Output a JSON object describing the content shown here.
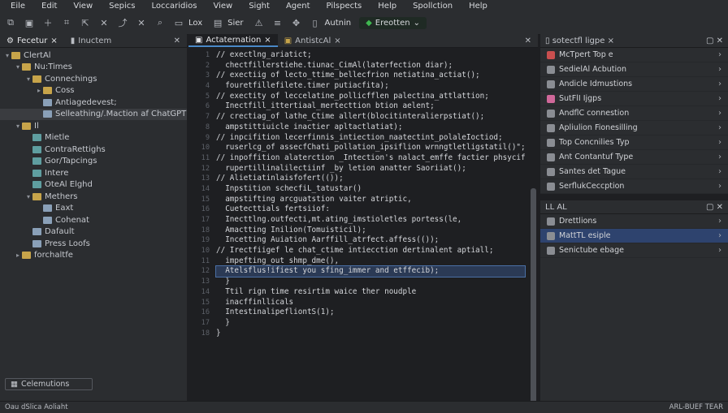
{
  "menu": [
    "Eile",
    "Edit",
    "View",
    "Sepics",
    "Loccaridios",
    "View",
    "Sight",
    "Agent",
    "Pilspects",
    "Help",
    "Spollction",
    "Help"
  ],
  "toolbar": {
    "icons": [
      "copy-icon",
      "save-icon",
      "add-icon",
      "graph-icon",
      "export-icon",
      "close-icon",
      "share-icon",
      "pin-icon",
      "search-icon"
    ],
    "item1_label": "Lox",
    "item2_label": "Sier",
    "item3_label": "Autnin",
    "run_label": "Ereotten"
  },
  "left_tabs": [
    {
      "label": "Fecetur"
    },
    {
      "label": "Inuctem"
    }
  ],
  "tree": [
    {
      "label": "ClertAl",
      "depth": 0,
      "arrow": "▾",
      "kind": "folder"
    },
    {
      "label": "Nu:Times",
      "depth": 1,
      "arrow": "▾",
      "kind": "folder"
    },
    {
      "label": "Connechings",
      "depth": 2,
      "arrow": "▾",
      "kind": "folder"
    },
    {
      "label": "Coss",
      "depth": 3,
      "arrow": "▸",
      "kind": "folder"
    },
    {
      "label": "Antiagedevest;",
      "depth": 3,
      "arrow": "",
      "kind": "file"
    },
    {
      "label": "Selleathing/.Maction af ChatGPT",
      "depth": 3,
      "arrow": "",
      "kind": "file",
      "selected": true
    },
    {
      "label": "Il",
      "depth": 1,
      "arrow": "▾",
      "kind": "folder"
    },
    {
      "label": "Mietle",
      "depth": 2,
      "arrow": "",
      "kind": "py"
    },
    {
      "label": "ContraRettighs",
      "depth": 2,
      "arrow": "",
      "kind": "py"
    },
    {
      "label": "Gor/Tapcings",
      "depth": 2,
      "arrow": "",
      "kind": "py"
    },
    {
      "label": "Intere",
      "depth": 2,
      "arrow": "",
      "kind": "py"
    },
    {
      "label": "OteAl Elghd",
      "depth": 2,
      "arrow": "",
      "kind": "py"
    },
    {
      "label": "Methers",
      "depth": 2,
      "arrow": "▾",
      "kind": "folder"
    },
    {
      "label": "Eaxt",
      "depth": 3,
      "arrow": "",
      "kind": "file"
    },
    {
      "label": "Cohenat",
      "depth": 3,
      "arrow": "",
      "kind": "file"
    },
    {
      "label": "Dafault",
      "depth": 2,
      "arrow": "",
      "kind": "file"
    },
    {
      "label": "Press Loofs",
      "depth": 2,
      "arrow": "",
      "kind": "file"
    },
    {
      "label": "forchaltfe",
      "depth": 1,
      "arrow": "▸",
      "kind": "folder"
    }
  ],
  "left_footer": {
    "button": "Celemutions",
    "status": "Oau dSlica Aoliaht"
  },
  "editor_tabs": [
    {
      "label": "Actaternation",
      "active": true
    },
    {
      "label": "AntistcAl",
      "active": false
    }
  ],
  "code_lines": [
    "// exectlng_ariatict;",
    "  chectfillerstiehe.tiunac_CimAl(laterfection diar);",
    "// exectiig of lecto_ttime_bellecfrion netiatina_actiat();",
    "  fouretfillefilete.timer putiacfita);",
    "// exectity of leccelatine_pollicfflen palectina_attlattion;",
    "  Inectfill_ittertiaal_mertecttion btion aelent;",
    "// crectiag_of lathe_Ctime allert(blocitinteralierpstiat();",
    "  ampstittiuicle inactier apltactlatiat);",
    "// inpcifition lecerfinnis_intiection_naatectint_polaleIoctiod;",
    "  ruserlcg_of assecfChati_pollation_ipsiflion wrnngtletligstatil()\";",
    "// inpoffition alaterction _Intection's nalact_emffe factier phsycifile",
    "  rupertillinalilectiinf _by letion anatter Saoriiat();",
    "// Alietiatinlaisfofert(());",
    "  Inpstition schecfiL_tatustar()",
    "  ampstifting arcguatstion vaiter atriptic,",
    "  Cuetecttials fertsiiof:",
    "  Inecttlng.outfecti,mt.ating_imstioletles portess(le,",
    "  Amactting Inilion(Tomuisticil);",
    "  Incetting Auiation Aarffill_atrfect.affess(());",
    "// Irectfiigef le chat_ctime intiecction dertinalent aptiall;",
    "  impefting_out shmp_dme(),",
    "  Atelsflus!ifiest you sfing_immer and etffecib);",
    "  }",
    "  Ttil rign time resirtim waice ther noudple",
    "  inacffinllicals",
    "  IntestinalipefliontS(1);",
    "  }",
    "}"
  ],
  "line_numbers": [
    "1",
    "2",
    "3",
    "4",
    "5",
    "6",
    "7",
    "8",
    "9",
    "10",
    "11",
    "12",
    "13",
    "14",
    "15",
    "16",
    "17",
    "18",
    "19",
    "10",
    "11",
    "12",
    "13",
    "14",
    "15",
    "16",
    "17",
    "18"
  ],
  "right_panel": {
    "title": "sotectfl ligpe",
    "rows": [
      {
        "label": "McTpert Top e",
        "color": "#c94f4f"
      },
      {
        "label": "SedielAl Acbution",
        "color": "#8a8d93"
      },
      {
        "label": "Andicle Idmustions",
        "color": "#8a8d93"
      },
      {
        "label": "SutFlI Ijgps",
        "color": "#d0689a"
      },
      {
        "label": "AndflC connestion",
        "color": "#8a8d93"
      },
      {
        "label": "Apliulion Fionesilling",
        "color": "#8a8d93"
      },
      {
        "label": "Top Concnilies Typ",
        "color": "#8a8d93"
      },
      {
        "label": "Ant Contantuf Type",
        "color": "#8a8d93"
      },
      {
        "label": "Santes det Tague",
        "color": "#8a8d93"
      },
      {
        "label": "SerflukCeccption",
        "color": "#8a8d93"
      }
    ],
    "section2_title": "LL AL",
    "rows2": [
      {
        "label": "Drettlions",
        "color": "#8a8d93"
      },
      {
        "label": "MattTL esiple",
        "color": "#8a8d93",
        "selected": true
      },
      {
        "label": "Senictube ebage",
        "color": "#8a8d93"
      }
    ]
  },
  "status_right": "ARL-BUEF TEAR"
}
